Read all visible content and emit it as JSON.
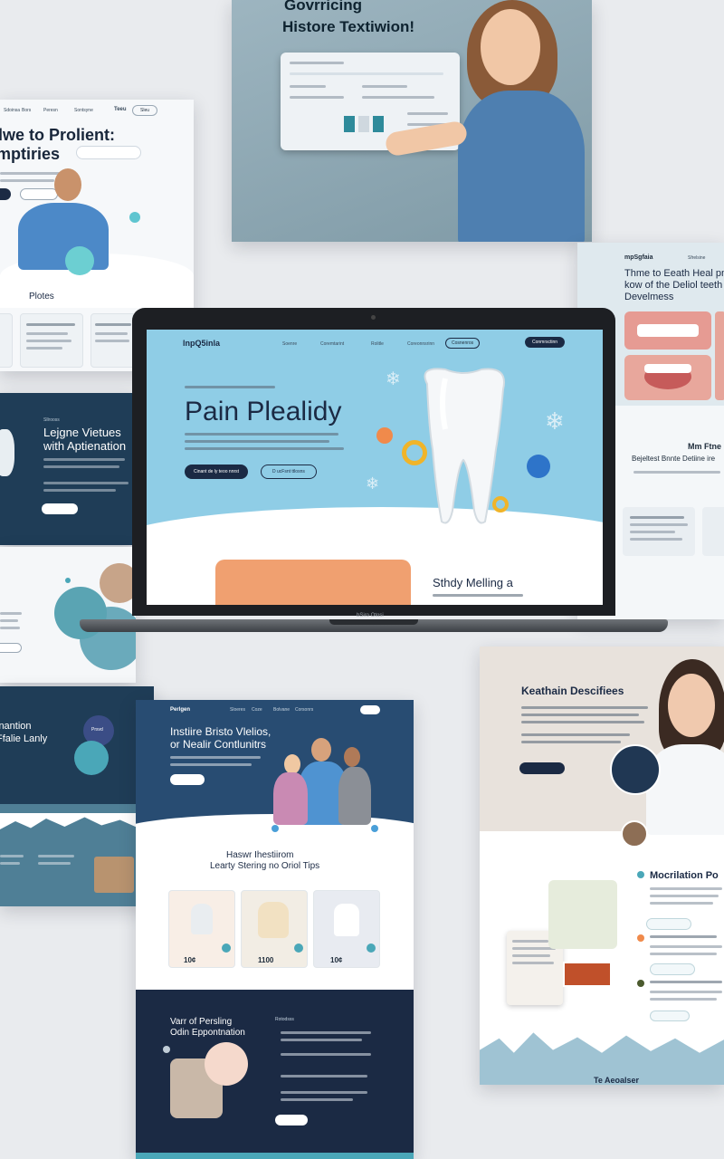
{
  "top_card": {
    "title_line1": "Govrricing",
    "title_line2": "Histore Textiwion!"
  },
  "left_top_card": {
    "nav_brand": "Teeu",
    "headline_line1": "lwe to Prolient:",
    "headline_line2": "mptiries",
    "section_title": "Plotes"
  },
  "right_top_card": {
    "brand": "mpSgfaia",
    "headline": "Thme to Eeath Heal pne kow of the Deliol teeth Develmess",
    "section_title": "Mm Ftne",
    "section_sub": "Bejeltest Bnnte Detiine ire"
  },
  "left_mid_card": {
    "headline_line1": "Lejgne Vietues",
    "headline_line2": "with Aptienation"
  },
  "laptop": {
    "brand_label": "bSiro Otosi",
    "site": {
      "logo": "lnpQ5inla",
      "nav": [
        "Soenre",
        "Coremtarint",
        "Rolitle",
        "Coreonnsrinn",
        "Cosnenros"
      ],
      "cta": "Conmrsctinn",
      "hero_title": "Pain Plealidy",
      "btn_primary": "Cinant de ly teoo nnrst",
      "btn_secondary": "D ucFsnt ttlosns",
      "section_title": "Sthdy Melling a"
    }
  },
  "left_lower_card": {
    "headline_line1": "inantion",
    "headline_line2": "Ffalie Lanly",
    "circle_label": "Prsvd"
  },
  "center_bottom_card": {
    "brand": "Perlgen",
    "headline_line1": "Instiire Bristo Vlelios,",
    "headline_line2": "or Nealir Contlunitrs",
    "section_line1": "Haswr Ihestiirom",
    "section_line2": "Learty Stering no Oriol Tips",
    "prices": [
      "10¢",
      "1100",
      "10¢"
    ],
    "dark_title_line1": "Varr of Persling",
    "dark_title_line2": "Odin Eppontnation"
  },
  "right_bottom_card": {
    "headline": "Keathain Descifiees",
    "section_title": "Mocrilation Po",
    "footer_label": "Te Aeoalser"
  },
  "colors": {
    "navy": "#1b2a44",
    "sky": "#8fcde6",
    "teal": "#4aa7b8",
    "orange": "#f08a4b"
  }
}
